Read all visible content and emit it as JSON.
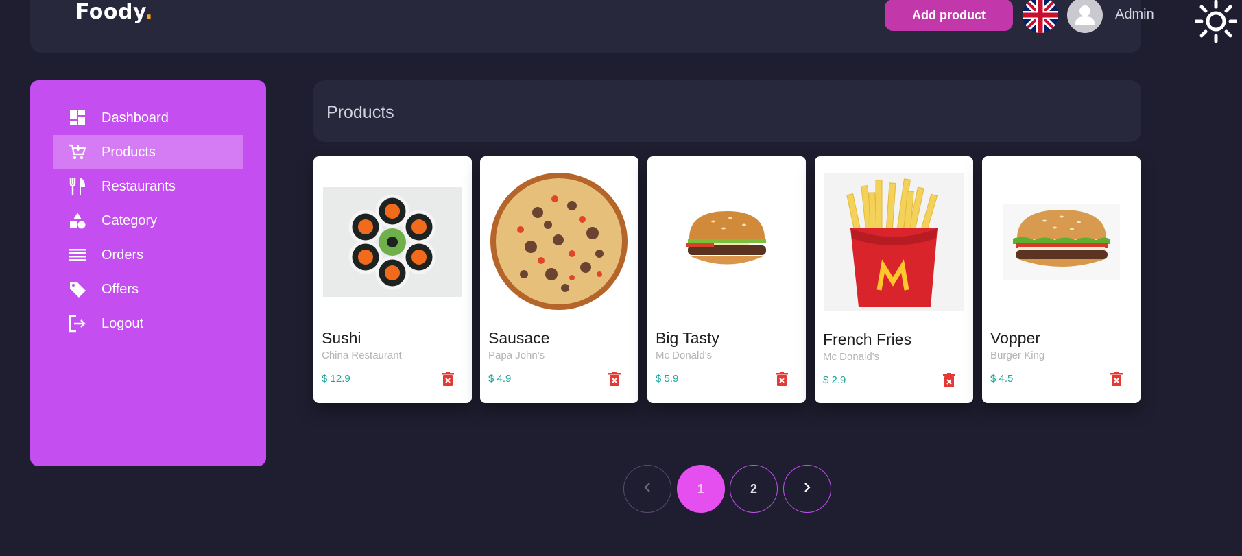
{
  "header": {
    "logo_text": "Foody",
    "logo_dot": ".",
    "add_button_label": "Add product",
    "user_name": "Admin"
  },
  "sidebar": {
    "items": [
      {
        "label": "Dashboard",
        "icon": "dashboard-icon"
      },
      {
        "label": "Products",
        "icon": "cart-icon",
        "active": true
      },
      {
        "label": "Restaurants",
        "icon": "utensils-icon"
      },
      {
        "label": "Category",
        "icon": "shapes-icon"
      },
      {
        "label": "Orders",
        "icon": "list-icon"
      },
      {
        "label": "Offers",
        "icon": "tag-icon"
      },
      {
        "label": "Logout",
        "icon": "logout-icon"
      }
    ]
  },
  "main": {
    "title": "Products",
    "products": [
      {
        "name": "Sushi",
        "restaurant": "China Restaurant",
        "price": "$ 12.9"
      },
      {
        "name": "Sausace",
        "restaurant": "Papa John's",
        "price": "$ 4.9"
      },
      {
        "name": "Big Tasty",
        "restaurant": "Mc Donald's",
        "price": "$ 5.9"
      },
      {
        "name": "French Fries",
        "restaurant": "Mc Donald's",
        "price": "$ 2.9"
      },
      {
        "name": "Vopper",
        "restaurant": "Burger King",
        "price": "$ 4.5"
      }
    ]
  },
  "pagination": {
    "prev_icon": "chevron-left-icon",
    "pages": [
      "1",
      "2"
    ],
    "current": "1",
    "next_icon": "chevron-right-icon"
  },
  "colors": {
    "background": "#1e1e30",
    "panel": "#27283c",
    "sidebar": "#c44ef0",
    "accent_button": "#c237a9",
    "price": "#1ea59b",
    "delete": "#e53935"
  }
}
